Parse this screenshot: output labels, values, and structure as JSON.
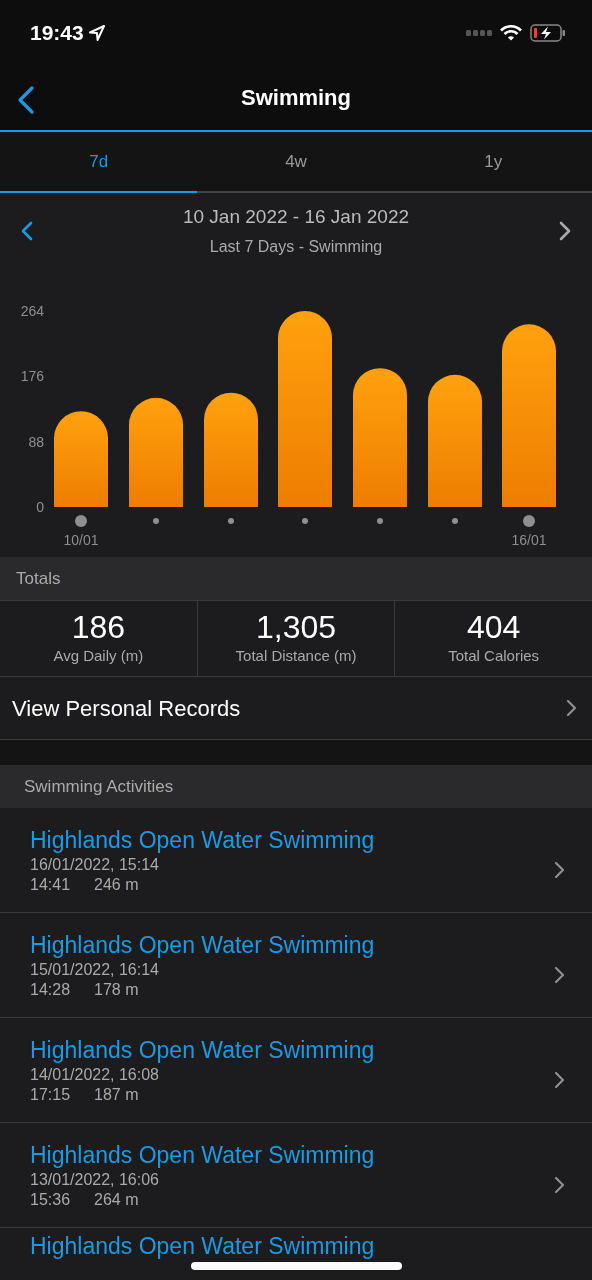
{
  "status_bar": {
    "time": "19:43"
  },
  "nav": {
    "title": "Swimming"
  },
  "tabs": [
    {
      "label": "7d",
      "selected": true
    },
    {
      "label": "4w",
      "selected": false
    },
    {
      "label": "1y",
      "selected": false
    }
  ],
  "period": {
    "range": "10 Jan 2022 - 16 Jan 2022",
    "subtitle": "Last 7 Days - Swimming"
  },
  "chart_data": {
    "type": "bar",
    "categories": [
      "10/01",
      null,
      null,
      null,
      null,
      null,
      "16/01"
    ],
    "values": [
      129,
      147,
      154,
      264,
      187,
      178,
      246
    ],
    "ylim": [
      0,
      264
    ],
    "yticks": [
      0,
      88,
      176,
      264
    ]
  },
  "totals": {
    "header": "Totals",
    "stats": [
      {
        "value": "186",
        "label": "Avg Daily (m)"
      },
      {
        "value": "1,305",
        "label": "Total Distance (m)"
      },
      {
        "value": "404",
        "label": "Total Calories"
      }
    ]
  },
  "personal_records": {
    "label": "View Personal Records"
  },
  "activities": {
    "header": "Swimming Activities",
    "items": [
      {
        "title": "Highlands Open Water Swimming",
        "datetime": "16/01/2022, 15:14",
        "duration": "14:41",
        "distance": "246 m"
      },
      {
        "title": "Highlands Open Water Swimming",
        "datetime": "15/01/2022, 16:14",
        "duration": "14:28",
        "distance": "178 m"
      },
      {
        "title": "Highlands Open Water Swimming",
        "datetime": "14/01/2022, 16:08",
        "duration": "17:15",
        "distance": "187 m"
      },
      {
        "title": "Highlands Open Water Swimming",
        "datetime": "13/01/2022, 16:06",
        "duration": "15:36",
        "distance": "264 m"
      },
      {
        "title": "Highlands Open Water Swimming"
      }
    ]
  }
}
